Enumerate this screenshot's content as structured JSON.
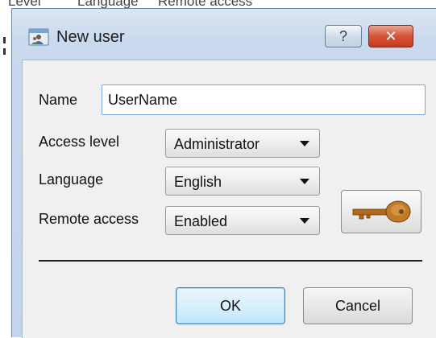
{
  "background_window": {
    "headers": [
      "Level",
      "Language",
      "Remote access"
    ]
  },
  "dialog": {
    "title": "New user",
    "help_label": "?",
    "close_label": "✕"
  },
  "form": {
    "name_label": "Name",
    "name_value": "UserName",
    "access_level_label": "Access level",
    "access_level_value": "Administrator",
    "language_label": "Language",
    "language_value": "English",
    "remote_access_label": "Remote access",
    "remote_access_value": "Enabled"
  },
  "icons": {
    "app": "user-window-icon",
    "key": "key-icon",
    "key_color": "#b06a1c"
  },
  "buttons": {
    "ok_label": "OK",
    "cancel_label": "Cancel"
  }
}
